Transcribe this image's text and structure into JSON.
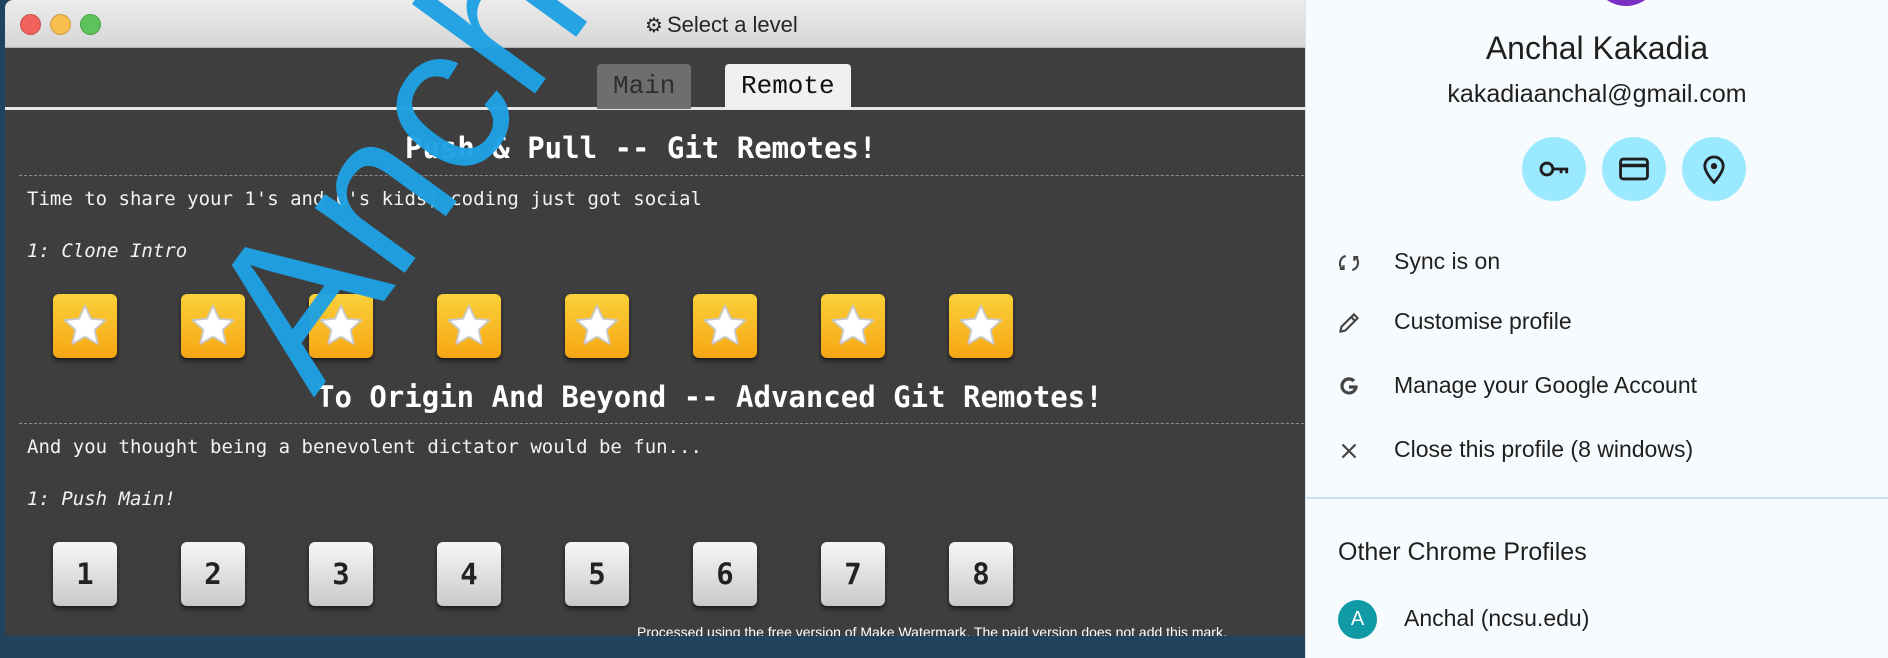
{
  "window": {
    "title": "Select a level",
    "title_icon": "gear-icon",
    "controls": [
      "close",
      "minimize",
      "maximize"
    ]
  },
  "tabs": [
    {
      "label": "Main",
      "active": false
    },
    {
      "label": "Remote",
      "active": true
    }
  ],
  "sections": [
    {
      "title": "Push & Pull -- Git Remotes!",
      "description": "Time to share your 1's and 0's kids; coding just got social",
      "sublevel": "1: Clone Intro",
      "levels": [
        {
          "type": "star",
          "completed": true
        },
        {
          "type": "star",
          "completed": true
        },
        {
          "type": "star",
          "completed": true
        },
        {
          "type": "star",
          "completed": true
        },
        {
          "type": "star",
          "completed": true
        },
        {
          "type": "star",
          "completed": true
        },
        {
          "type": "star",
          "completed": true
        },
        {
          "type": "star",
          "completed": true
        }
      ]
    },
    {
      "title": "To Origin And Beyond -- Advanced Git Remotes!",
      "description": "And you thought being a benevolent dictator would be fun...",
      "sublevel": "1: Push Main!",
      "levels": [
        {
          "label": "1"
        },
        {
          "label": "2"
        },
        {
          "label": "3"
        },
        {
          "label": "4"
        },
        {
          "label": "5"
        },
        {
          "label": "6"
        },
        {
          "label": "7"
        },
        {
          "label": "8"
        }
      ]
    }
  ],
  "watermark": {
    "text": "Anchal",
    "notice": "Processed using the free version of Make Watermark. The paid version does not add this mark."
  },
  "profile_panel": {
    "name": "Anchal Kakadia",
    "email": "kakadiaanchal@gmail.com",
    "quick_actions": [
      {
        "icon": "key-icon",
        "label": "Passwords"
      },
      {
        "icon": "credit-card-icon",
        "label": "Payment methods"
      },
      {
        "icon": "location-pin-icon",
        "label": "Addresses"
      }
    ],
    "menu": [
      {
        "icon": "sync-icon",
        "label": "Sync is on"
      },
      {
        "icon": "pencil-icon",
        "label": "Customise profile"
      },
      {
        "icon": "google-icon",
        "label": "Manage your Google Account"
      },
      {
        "icon": "close-icon",
        "label": "Close this profile (8 windows)"
      }
    ],
    "other_heading": "Other Chrome Profiles",
    "other_profiles": [
      {
        "initial": "A",
        "label": "Anchal (ncsu.edu)"
      }
    ]
  },
  "colors": {
    "board_bg": "#3e3e3e",
    "star_tile": "#f8bd1f",
    "quick_action_bg": "#9be9ff",
    "watermark": "#1ea1e3",
    "avatar": "#7b2fc4",
    "profile_avatar": "#0f9aa6"
  }
}
